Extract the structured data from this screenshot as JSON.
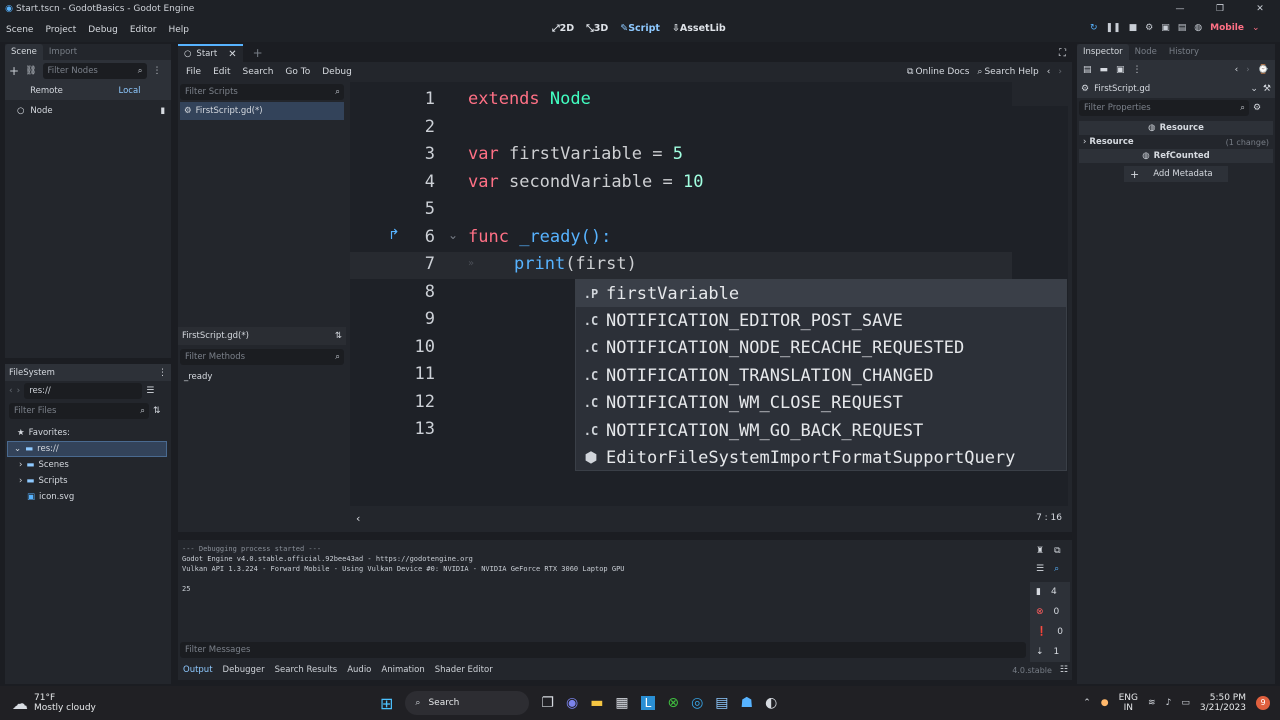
{
  "window": {
    "title": "Start.tscn - GodotBasics - Godot Engine"
  },
  "menubar": {
    "items": [
      "Scene",
      "Project",
      "Debug",
      "Editor",
      "Help"
    ],
    "workspaces": [
      "2D",
      "3D",
      "Script",
      "AssetLib"
    ],
    "renderer": "Mobile"
  },
  "scene_dock": {
    "tabs": [
      "Scene",
      "Import"
    ],
    "filter_placeholder": "Filter Nodes",
    "remote": "Remote",
    "local": "Local",
    "root_node": "Node"
  },
  "filesystem": {
    "title": "FileSystem",
    "path": "res://",
    "filter_placeholder": "Filter Files",
    "favorites": "Favorites:",
    "items": [
      "res://",
      "Scenes",
      "Scripts",
      "icon.svg"
    ]
  },
  "editor_tabs": {
    "tab": "Start"
  },
  "script_menu": {
    "items": [
      "File",
      "Edit",
      "Search",
      "Go To",
      "Debug"
    ],
    "online_docs": "Online Docs",
    "search_help": "Search Help"
  },
  "scripts_panel": {
    "filter_placeholder": "Filter Scripts",
    "script": "FirstScript.gd(*)",
    "methods_title": "FirstScript.gd(*)",
    "methods_placeholder": "Filter Methods",
    "methods": [
      "_ready"
    ]
  },
  "code": {
    "line_numbers": [
      "1",
      "2",
      "3",
      "4",
      "5",
      "6",
      "7",
      "8",
      "9",
      "10",
      "11",
      "12",
      "13"
    ],
    "l1a": "extends",
    "l1b": "Node",
    "l3a": "var",
    "l3b": "firstVariable",
    "l3c": "=",
    "l3d": "5",
    "l4a": "var",
    "l4b": "secondVariable",
    "l4c": "=",
    "l4d": "10",
    "l6a": "func",
    "l6b": "_ready():",
    "l7a": "print",
    "l7b": "(first)",
    "cursor": "7 :  16"
  },
  "autocomplete": [
    {
      "kind": ".P",
      "text": "firstVariable"
    },
    {
      "kind": ".C",
      "text": "NOTIFICATION_EDITOR_POST_SAVE"
    },
    {
      "kind": ".C",
      "text": "NOTIFICATION_NODE_RECACHE_REQUESTED"
    },
    {
      "kind": ".C",
      "text": "NOTIFICATION_TRANSLATION_CHANGED"
    },
    {
      "kind": ".C",
      "text": "NOTIFICATION_WM_CLOSE_REQUEST"
    },
    {
      "kind": ".C",
      "text": "NOTIFICATION_WM_GO_BACK_REQUEST"
    },
    {
      "kind": "cube-icon",
      "text": "EditorFileSystemImportFormatSupportQuery"
    }
  ],
  "output": {
    "lines": [
      "--- Debugging process started ---",
      "Godot Engine v4.0.stable.official.92bee43ad - https://godotengine.org",
      "Vulkan API 1.3.224 - Forward Mobile - Using Vulkan Device #0: NVIDIA - NVIDIA GeForce RTX 3060 Laptop GPU",
      "",
      "25"
    ],
    "filter_placeholder": "Filter Messages",
    "counts": [
      "4",
      "0",
      "0",
      "1"
    ],
    "tabs": [
      "Output",
      "Debugger",
      "Search Results",
      "Audio",
      "Animation",
      "Shader Editor"
    ],
    "version": "4.0.stable"
  },
  "inspector": {
    "tabs": [
      "Inspector",
      "Node",
      "History"
    ],
    "file": "FirstScript.gd",
    "filter_placeholder": "Filter Properties",
    "resource_header": "Resource",
    "resource_row": "Resource",
    "change": "(1 change)",
    "refcounted": "RefCounted",
    "add_metadata": "Add Metadata"
  },
  "taskbar": {
    "temp": "71°F",
    "weather": "Mostly cloudy",
    "search": "Search",
    "lang1": "ENG",
    "lang2": "IN",
    "time": "5:50 PM",
    "date": "3/21/2023",
    "notif": "9"
  },
  "colors": {
    "accent": "#57b3ff",
    "keyword": "#ff7085",
    "type": "#42ffc2"
  }
}
